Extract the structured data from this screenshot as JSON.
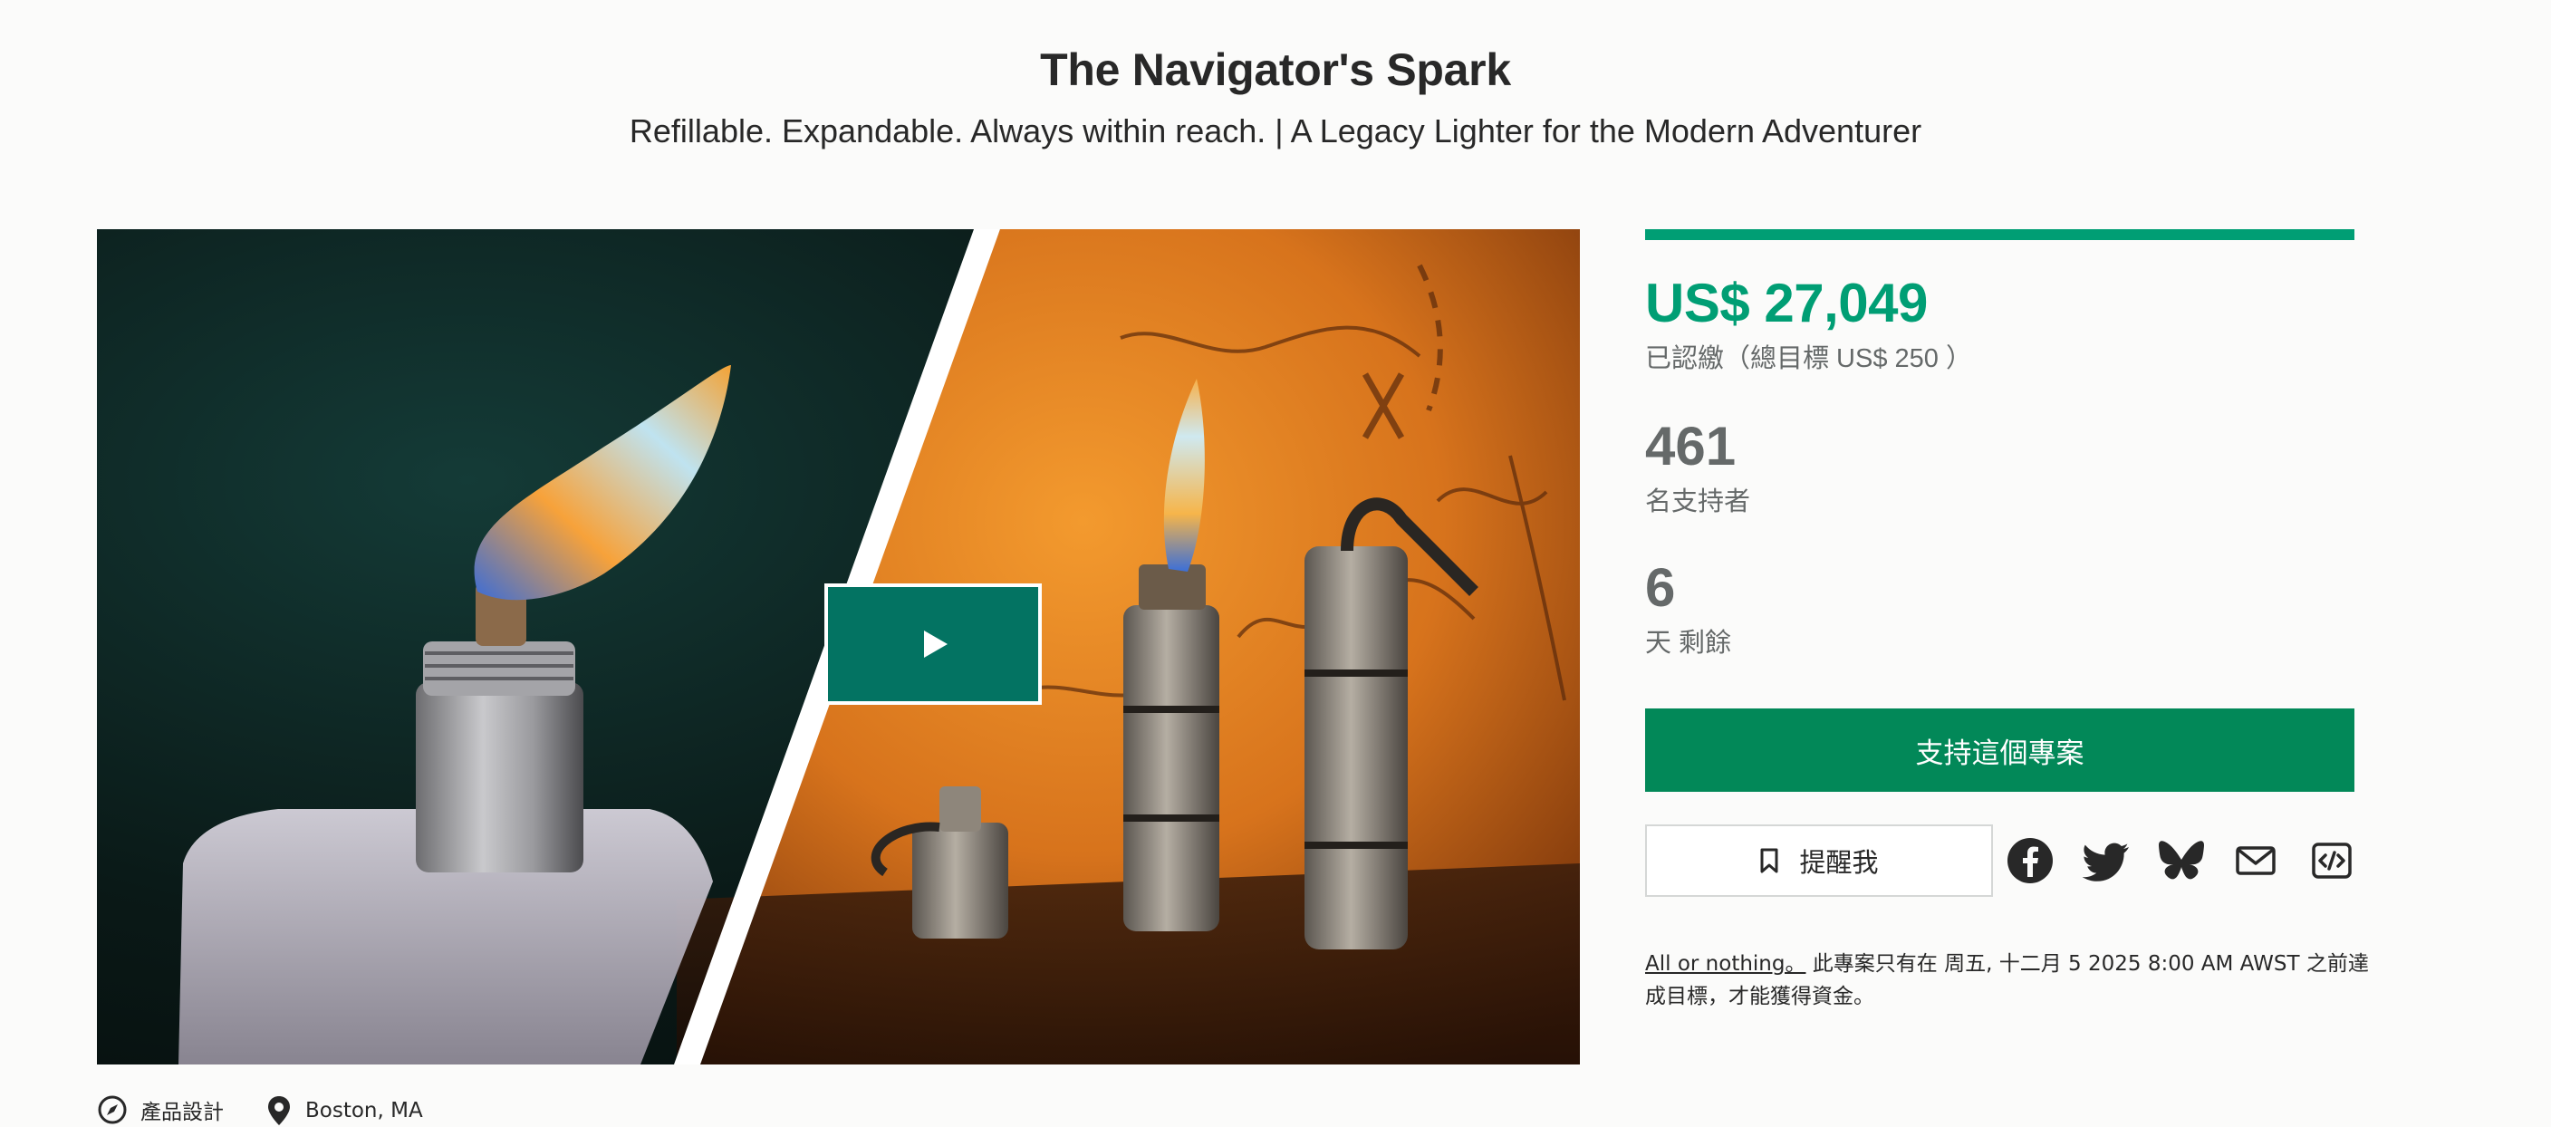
{
  "project": {
    "title": "The Navigator's Spark",
    "subtitle": "Refillable. Expandable. Always within reach. | A Legacy Lighter for the Modern Adventurer"
  },
  "stats": {
    "pledged_amount": "US$ 27,049",
    "pledged_label": "已認繳（總目標 US$ 250 ）",
    "backers_count": "461",
    "backers_label": "名支持者",
    "days_left": "6",
    "days_label": "天 剩餘",
    "progress_fraction": 1.0
  },
  "actions": {
    "back_label": "支持這個專案",
    "remind_label": "提醒我"
  },
  "share": {
    "icons": [
      "facebook-icon",
      "twitter-icon",
      "bluesky-icon",
      "email-icon",
      "embed-icon"
    ]
  },
  "notice": {
    "link_text": "All or nothing。",
    "text": " 此專案只有在 周五, 十二月 5 2025 8:00 AM AWST 之前達成目標，才能獲得資金。"
  },
  "meta": {
    "category": "產品設計",
    "location": "Boston, MA"
  },
  "colors": {
    "accent": "#009e74",
    "button": "#028858",
    "play_button": "#037362",
    "muted_text": "#656969"
  }
}
